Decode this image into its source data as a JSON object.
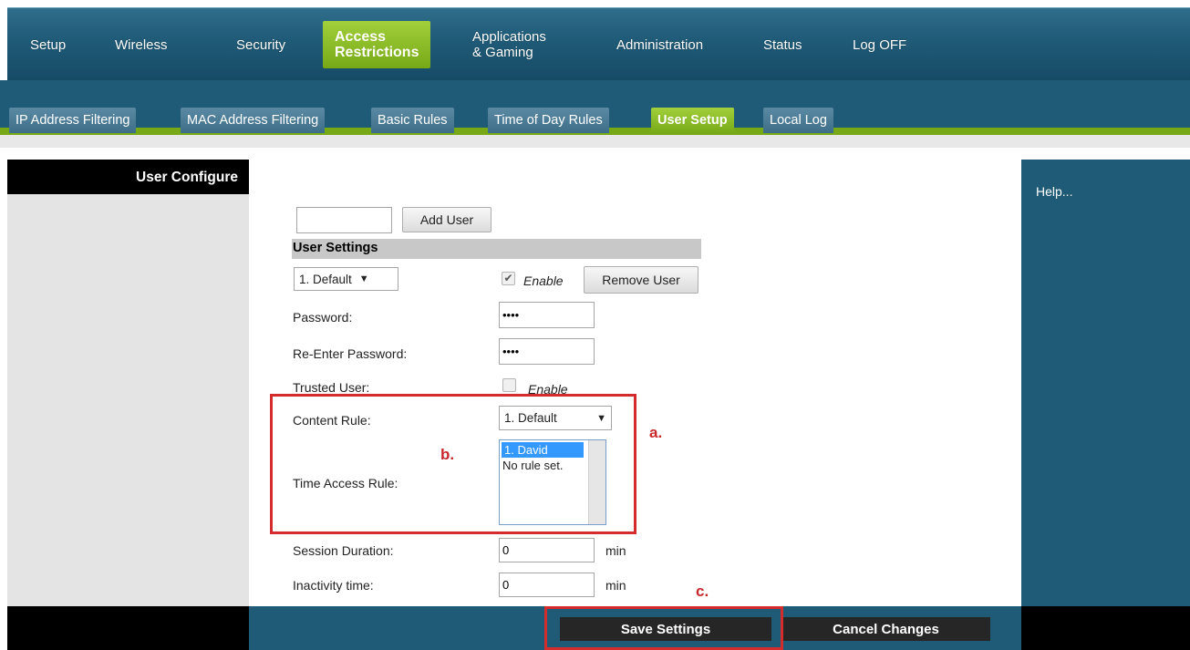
{
  "nav": {
    "items": [
      {
        "label": "Setup"
      },
      {
        "label": "Wireless"
      },
      {
        "label": "Security"
      },
      {
        "label_line1": "Access",
        "label_line2": "Restrictions"
      },
      {
        "label_line1": "Applications",
        "label_line2": "& Gaming"
      },
      {
        "label": "Administration"
      },
      {
        "label": "Status"
      },
      {
        "label": "Log OFF"
      }
    ],
    "active": "Access Restrictions"
  },
  "subtabs": {
    "items": [
      {
        "label": "IP Address Filtering"
      },
      {
        "label": "MAC Address Filtering"
      },
      {
        "label": "Basic Rules"
      },
      {
        "label": "Time of Day Rules"
      },
      {
        "label": "User Setup"
      },
      {
        "label": "Local Log"
      }
    ],
    "active": "User Setup"
  },
  "left": {
    "heading": "User Configure"
  },
  "right": {
    "help_label": "Help..."
  },
  "form": {
    "new_user_value": "",
    "add_user_label": "Add User",
    "section_title": "User Settings",
    "user_select": {
      "value": "1. Default"
    },
    "enable_label": "Enable",
    "enable_checked": true,
    "remove_user_label": "Remove User",
    "password_label": "Password:",
    "password_value": "••••",
    "reenter_password_label": "Re-Enter Password:",
    "reenter_password_value": "••••",
    "trusted_user_label": "Trusted User:",
    "trusted_enable_label": "Enable",
    "trusted_checked": false,
    "content_rule_label": "Content Rule:",
    "content_rule_value": "1. Default",
    "time_access_rule_label": "Time Access Rule:",
    "time_access_options": [
      "1. David",
      "No rule set."
    ],
    "time_access_selected": "1. David",
    "session_duration_label": "Session Duration:",
    "session_duration_value": "0",
    "inactivity_time_label": "Inactivity time:",
    "inactivity_time_value": "0",
    "min_unit": "min"
  },
  "annotations": {
    "a": "a.",
    "b": "b.",
    "c": "c."
  },
  "footer": {
    "save_label": "Save Settings",
    "cancel_label": "Cancel Changes"
  },
  "colors": {
    "nav_blue": "#1f5a77",
    "accent_green": "#77a916",
    "annotation_red": "#d42c2c"
  },
  "icons": {
    "dropdown": "dropdown-arrow-icon",
    "checkbox": "checkmark-icon"
  }
}
